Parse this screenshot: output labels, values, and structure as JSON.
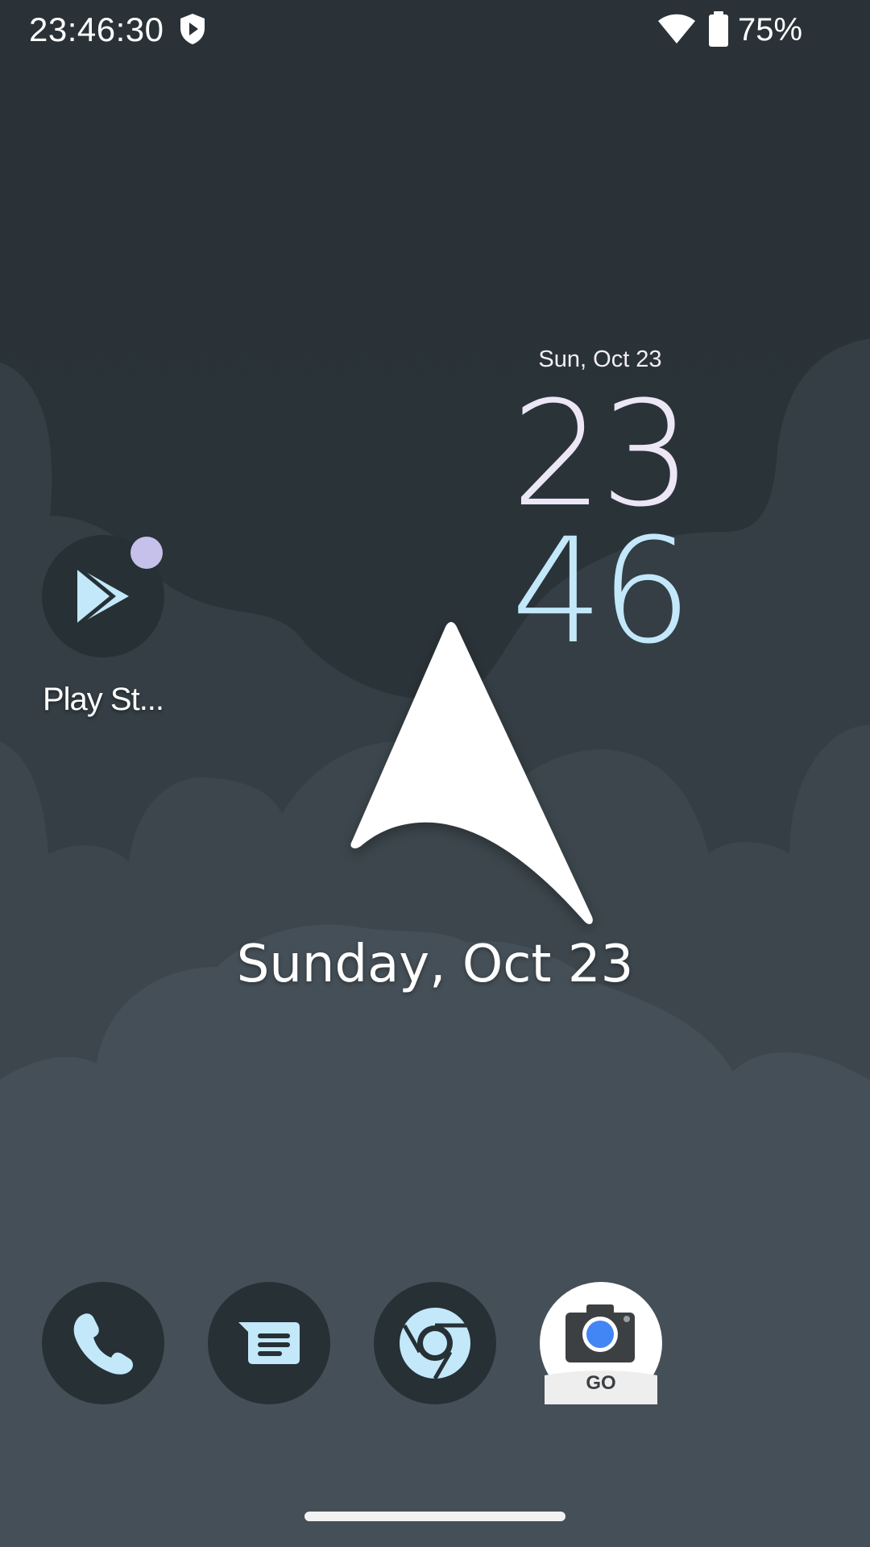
{
  "status_bar": {
    "time": "23:46:30",
    "battery_percent": "75%",
    "icons": [
      "shield-play-icon",
      "wifi-icon",
      "battery-icon"
    ]
  },
  "clock_widget": {
    "date": "Sun, Oct 23",
    "hours": "23",
    "minutes": "46"
  },
  "home_apps": [
    {
      "label": "Play St...",
      "icon": "play-store-icon",
      "has_notification": true
    }
  ],
  "glance": {
    "date": "Sunday, Oct 23"
  },
  "dock": [
    {
      "icon": "phone-icon"
    },
    {
      "icon": "messages-icon"
    },
    {
      "icon": "chrome-icon"
    },
    {
      "icon": "camera-go-icon",
      "badge_text": "GO"
    }
  ],
  "colors": {
    "accent_blue": "#c2e8fa",
    "icon_bg": "#263035",
    "notification_dot": "#c6c1eb"
  }
}
